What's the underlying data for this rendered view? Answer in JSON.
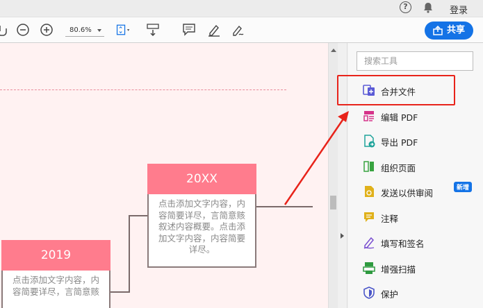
{
  "topbar": {
    "help": "?",
    "login": "登录"
  },
  "toolbar": {
    "zoom": "80.6%",
    "share": "共享"
  },
  "canvas": {
    "card_2019": {
      "title": "2019",
      "text": "点击添加文字内容，内容简要详尽，言简意赅"
    },
    "card_20xx": {
      "title": "20XX",
      "text": "点击添加文字内容，内容简要详尽，言简意赅叙述内容概要。点击添加文字内容，内容简要详尽。"
    }
  },
  "panel": {
    "search_placeholder": "搜索工具",
    "tools": [
      {
        "label": "合并文件",
        "icon": "combine-files-icon",
        "color": "#5b5bd6"
      },
      {
        "label": "编辑 PDF",
        "icon": "edit-pdf-icon",
        "color": "#d6338a"
      },
      {
        "label": "导出 PDF",
        "icon": "export-pdf-icon",
        "color": "#1ea39a"
      },
      {
        "label": "组织页面",
        "icon": "organize-pages-icon",
        "color": "#38a340"
      },
      {
        "label": "发送以供审阅",
        "icon": "send-review-icon",
        "color": "#e0b11b",
        "badge": "新增"
      },
      {
        "label": "注释",
        "icon": "comment-icon",
        "color": "#e0b11b"
      },
      {
        "label": "填写和签名",
        "icon": "fill-sign-icon",
        "color": "#7a4fd0"
      },
      {
        "label": "增强扫描",
        "icon": "enhance-scan-icon",
        "color": "#2e9a3f"
      },
      {
        "label": "保护",
        "icon": "protect-icon",
        "color": "#4a55c8"
      }
    ]
  },
  "colors": {
    "accent": "#1473e6",
    "highlight": "#e8231a",
    "card": "#ff7c8d"
  }
}
